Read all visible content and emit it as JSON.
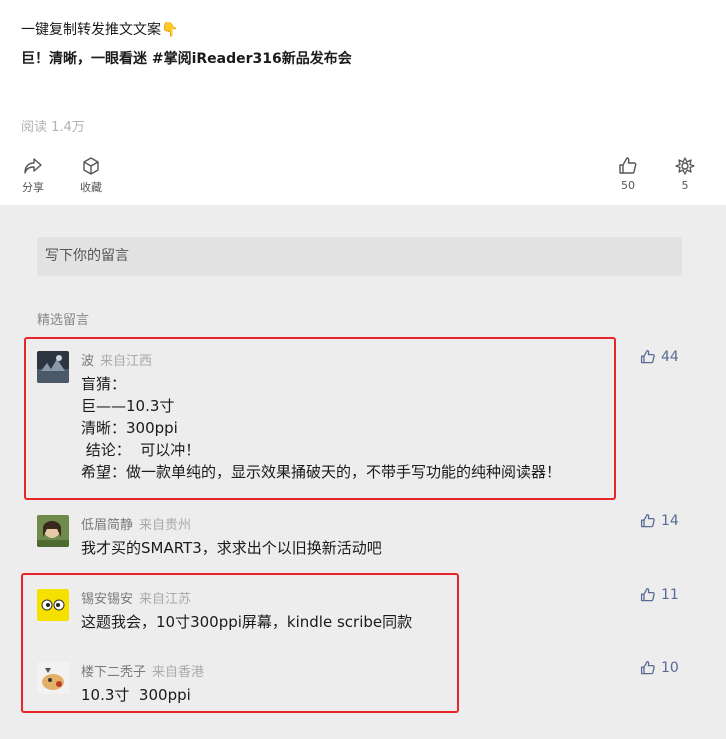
{
  "article": {
    "line1": "一键复制转发推文文案👇",
    "line2": "巨！清晰，一眼看迷 #掌阅iReader316新品发布会",
    "reads": "阅读 1.4万"
  },
  "actions": {
    "share": "分享",
    "collect": "收藏",
    "like_count": "50",
    "wow_count": "5"
  },
  "comment_input": {
    "placeholder": "写下你的留言"
  },
  "featured_label": "精选留言",
  "comments": [
    {
      "name": "波",
      "location": "来自江西",
      "lines": [
        "盲猜：",
        "巨——10.3寸",
        "清晰：300ppi",
        " 结论：  可以冲！",
        "希望：做一款单纯的，显示效果捅破天的，不带手写功能的纯种阅读器！"
      ],
      "likes": "44"
    },
    {
      "name": "低眉简静",
      "location": "来自贵州",
      "lines": [
        "我才买的SMART3，求求出个以旧换新活动吧"
      ],
      "likes": "14"
    },
    {
      "name": "锡安锡安",
      "location": "来自江苏",
      "lines": [
        "这题我会，10寸300ppi屏幕，kindle scribe同款"
      ],
      "likes": "11"
    },
    {
      "name": "楼下二秃子",
      "location": "来自香港",
      "lines": [
        "10.3寸  300ppi"
      ],
      "likes": "10"
    }
  ],
  "colors": {
    "accent": "#576b95",
    "highlight_box": "#e8262a",
    "background_gray": "#ededed"
  }
}
